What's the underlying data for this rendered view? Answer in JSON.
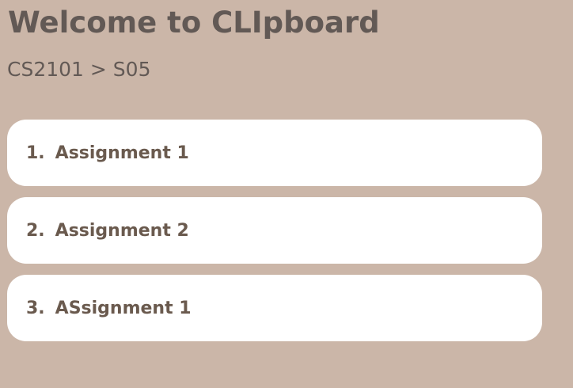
{
  "header": {
    "title": "Welcome to CLIpboard",
    "breadcrumb": "CS2101 > S05"
  },
  "assignments": [
    {
      "number": "1.",
      "label": "Assignment 1"
    },
    {
      "number": "2.",
      "label": "Assignment 2"
    },
    {
      "number": "3.",
      "label": "ASsignment 1"
    }
  ],
  "colors": {
    "background": "#cbb6a8",
    "card": "#ffffff",
    "title_text": "#625955",
    "card_text": "#6a5a4e"
  }
}
